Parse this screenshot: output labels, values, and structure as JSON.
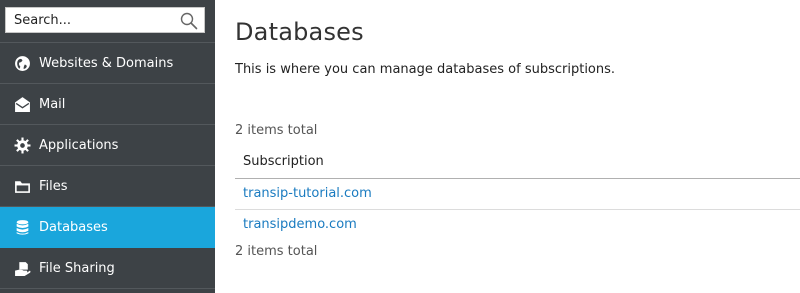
{
  "search": {
    "placeholder": "Search..."
  },
  "sidebar": {
    "items": [
      {
        "label": "Websites & Domains",
        "icon": "globe-icon"
      },
      {
        "label": "Mail",
        "icon": "mail-icon"
      },
      {
        "label": "Applications",
        "icon": "gear-icon"
      },
      {
        "label": "Files",
        "icon": "folder-icon"
      },
      {
        "label": "Databases",
        "icon": "database-icon",
        "active": true
      },
      {
        "label": "File Sharing",
        "icon": "file-sharing-icon"
      }
    ]
  },
  "main": {
    "title": "Databases",
    "description": "This is where you can manage databases of subscriptions.",
    "items_total_top": "2 items total",
    "items_total_bottom": "2 items total",
    "table": {
      "header": "Subscription",
      "rows": [
        "transip-tutorial.com",
        "transipdemo.com"
      ]
    }
  },
  "colors": {
    "sidebar_bg": "#3d4246",
    "active_bg": "#1aa6dc",
    "link": "#1a7bc0"
  }
}
